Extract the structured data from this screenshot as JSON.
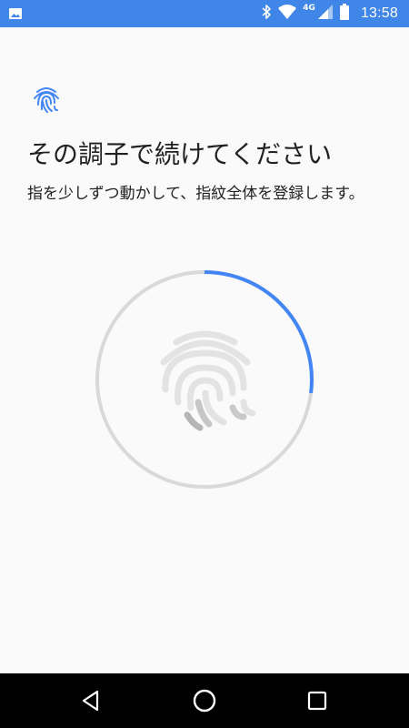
{
  "status_bar": {
    "time": "13:58",
    "network": "4G",
    "icons": [
      "image-notification-icon",
      "bluetooth-icon",
      "wifi-icon",
      "signal-icon",
      "battery-icon"
    ],
    "color": "#3f86e8"
  },
  "screen": {
    "title": "その調子で続けてください",
    "description": "指を少しずつ動かして、指紋全体を登録します。",
    "enrollment_progress_percent": 27,
    "accent_color": "#4285f4",
    "track_color": "#d9d9d9"
  },
  "nav_bar": {
    "buttons": [
      "back-icon",
      "home-icon",
      "recents-icon"
    ]
  }
}
